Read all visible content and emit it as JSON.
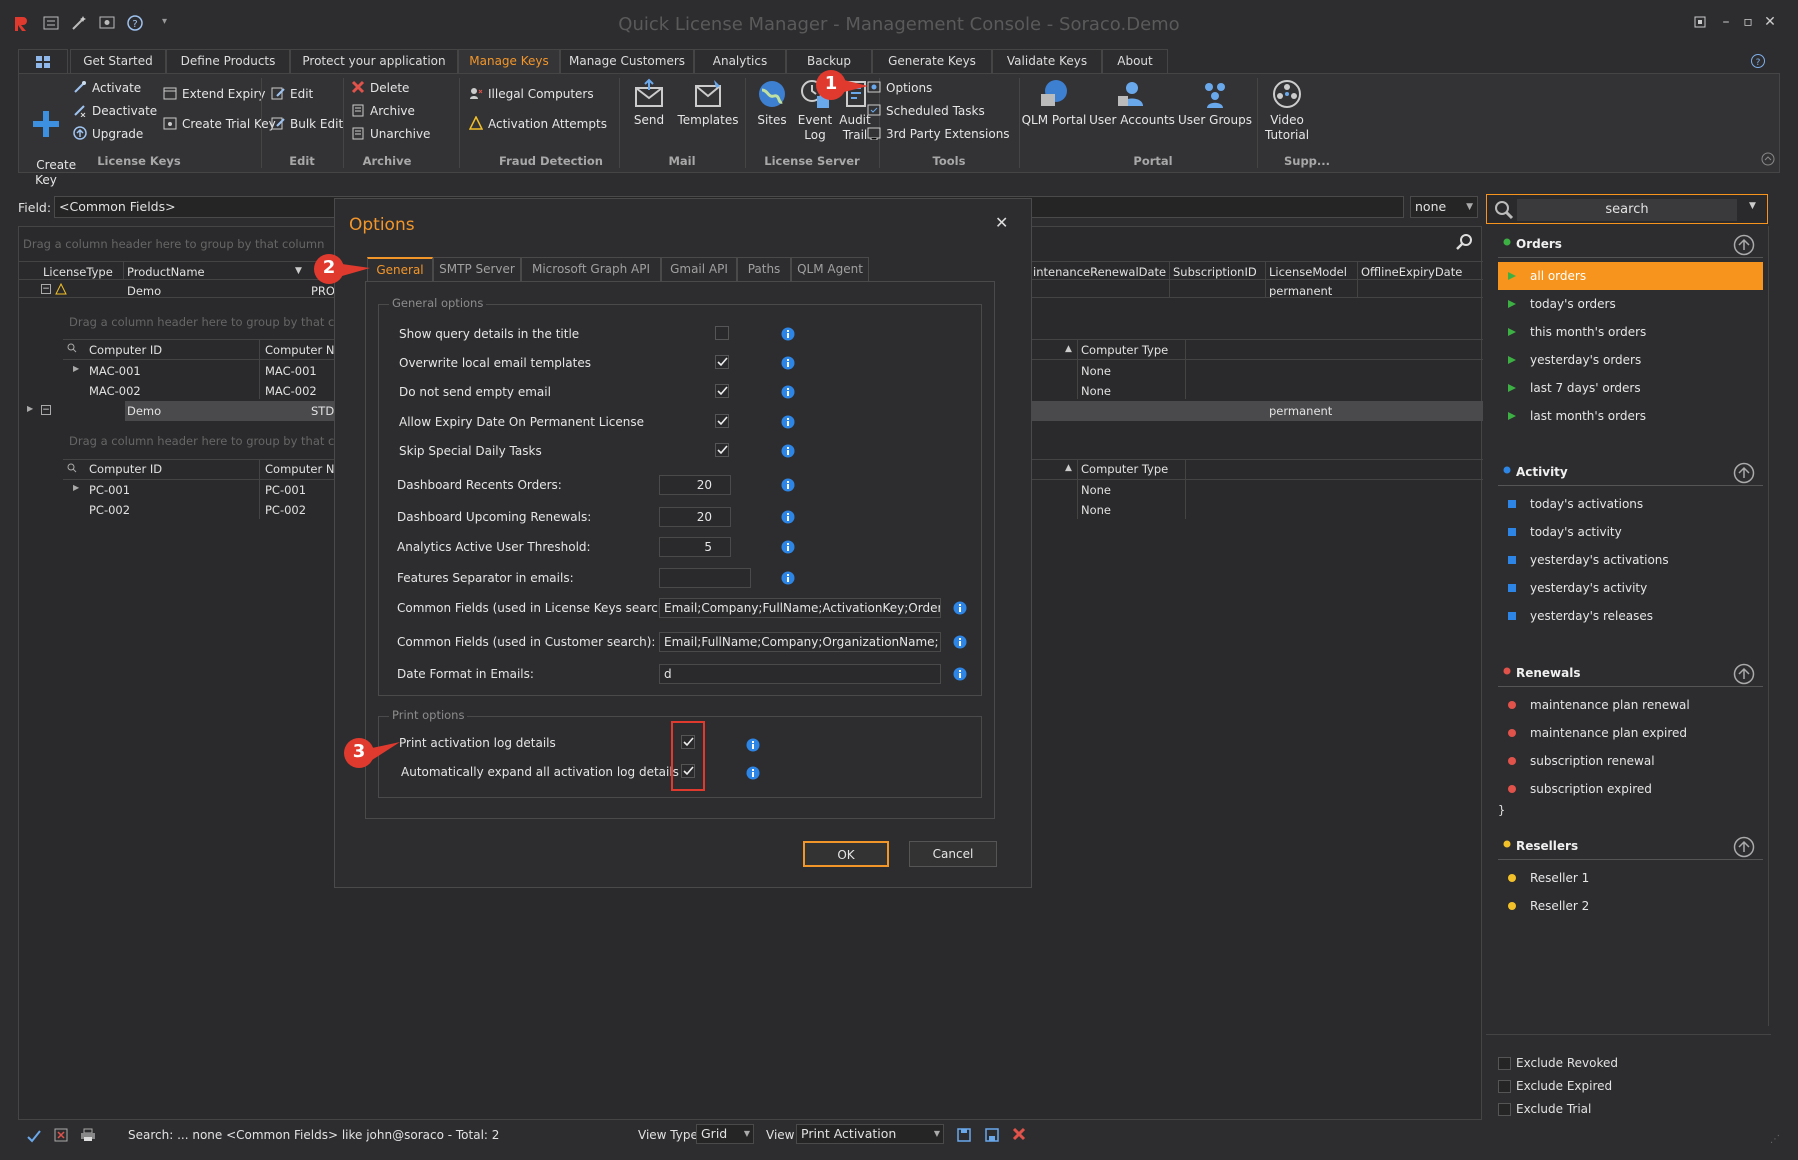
{
  "window": {
    "title": "Quick License Manager - Management Console - Soraco.Demo"
  },
  "tabs": [
    "Get Started",
    "Define Products",
    "Protect your application",
    "Manage Keys",
    "Manage Customers",
    "Analytics",
    "Backup",
    "Generate Keys",
    "Validate Keys",
    "About"
  ],
  "ribbon": {
    "create_key": "Create\nKey",
    "activate": "Activate",
    "deactivate": "Deactivate",
    "upgrade": "Upgrade",
    "extend_expiry": "Extend Expiry",
    "create_trial_key": "Create Trial Key",
    "edit": "Edit",
    "bulk_edit": "Bulk Edit",
    "delete": "Delete",
    "archive": "Archive",
    "unarchive": "Unarchive",
    "illegal_computers": "Illegal Computers",
    "activation_attempts": "Activation Attempts",
    "send": "Send",
    "templates": "Templates",
    "sites": "Sites",
    "event_log": "Event\nLog",
    "audit_trail": "Audit\nTrail",
    "options": "Options",
    "scheduled_tasks": "Scheduled Tasks",
    "third_party": "3rd Party Extensions",
    "qlm_portal": "QLM Portal",
    "user_accounts": "User Accounts",
    "user_groups": "User Groups",
    "video_tutorial": "Video\nTutorial",
    "groups": {
      "license_keys": "License Keys",
      "edit": "Edit",
      "archive": "Archive",
      "fraud": "Fraud Detection",
      "mail": "Mail",
      "license_server": "License Server",
      "tools": "Tools",
      "portal": "Portal",
      "support": "Supp..."
    }
  },
  "field": {
    "label": "Field:",
    "value": "<Common Fields>",
    "op": "none",
    "search": "search"
  },
  "grid": {
    "group_hint": "Drag a column header here to group by that column",
    "columns": [
      "LicenseType",
      "ProductName",
      "intenanceRenewalDate",
      "SubscriptionID",
      "LicenseModel",
      "OfflineExpiryDate"
    ],
    "rows": [
      {
        "product": "Demo",
        "code": "PRO",
        "model": "permanent",
        "sub_hint": "Drag a column header here to group by that colu",
        "sub_columns": [
          "Computer ID",
          "Computer Na",
          "Computer Type"
        ],
        "sub_rows": [
          [
            "MAC-001",
            "MAC-001",
            "None"
          ],
          [
            "MAC-002",
            "MAC-002",
            "None"
          ]
        ]
      },
      {
        "product": "Demo",
        "code": "STD",
        "model": "permanent",
        "sub_hint": "Drag a column header here to group by that colu",
        "sub_columns": [
          "Computer ID",
          "Computer Na",
          "Computer Type"
        ],
        "sub_rows": [
          [
            "PC-001",
            "PC-001",
            "None"
          ],
          [
            "PC-002",
            "PC-002",
            "None"
          ]
        ]
      }
    ]
  },
  "sidebar": {
    "orders": {
      "title": "Orders",
      "items": [
        "all orders",
        "today's orders",
        "this month's orders",
        "yesterday's orders",
        "last 7 days' orders",
        "last month's orders"
      ]
    },
    "activity": {
      "title": "Activity",
      "items": [
        "today's activations",
        "today's activity",
        "yesterday's activations",
        "yesterday's activity",
        "yesterday's releases"
      ]
    },
    "renewals": {
      "title": "Renewals",
      "items": [
        "maintenance plan renewal",
        "maintenance plan expired",
        "subscription renewal",
        "subscription expired"
      ]
    },
    "resellers": {
      "title": "Resellers",
      "items": [
        "Reseller 1",
        "Reseller 2"
      ]
    },
    "exclude": [
      "Exclude Revoked",
      "Exclude Expired",
      "Exclude Trial"
    ]
  },
  "status": {
    "search": "Search: ... none <Common Fields> like john@soraco  - Total: 2",
    "view_type_label": "View Type",
    "view_type": "Grid",
    "view_label": "View",
    "view": "Print Activation"
  },
  "dialog": {
    "title": "Options",
    "tabs": [
      "General",
      "SMTP Server",
      "Microsoft Graph API",
      "Gmail API",
      "Paths",
      "QLM Agent"
    ],
    "general_legend": "General options",
    "print_legend": "Print options",
    "show_query": "Show query details in the title",
    "overwrite": "Overwrite local email templates",
    "no_empty": "Do not send empty email",
    "allow_expiry": "Allow Expiry Date On Permanent License",
    "skip_daily": "Skip Special Daily Tasks",
    "recent_orders": "Dashboard Recents Orders:",
    "recent_orders_val": "20",
    "upcoming": "Dashboard Upcoming Renewals:",
    "upcoming_val": "20",
    "threshold": "Analytics Active User Threshold:",
    "threshold_val": "5",
    "separator": "Features Separator in emails:",
    "separator_val": "",
    "common_keys": "Common Fields (used in License Keys search):",
    "common_keys_val": "Email;Company;FullName;ActivationKey;OrderID;S",
    "common_cust": "Common Fields (used in Customer search):",
    "common_cust_val": "Email;FullName;Company;OrganizationName;",
    "date_format": "Date Format in Emails:",
    "date_format_val": "d",
    "print_log": "Print activation log details",
    "expand_log": "Automatically expand all activation log details",
    "ok": "OK",
    "cancel": "Cancel"
  },
  "callouts": [
    "1",
    "2",
    "3"
  ]
}
